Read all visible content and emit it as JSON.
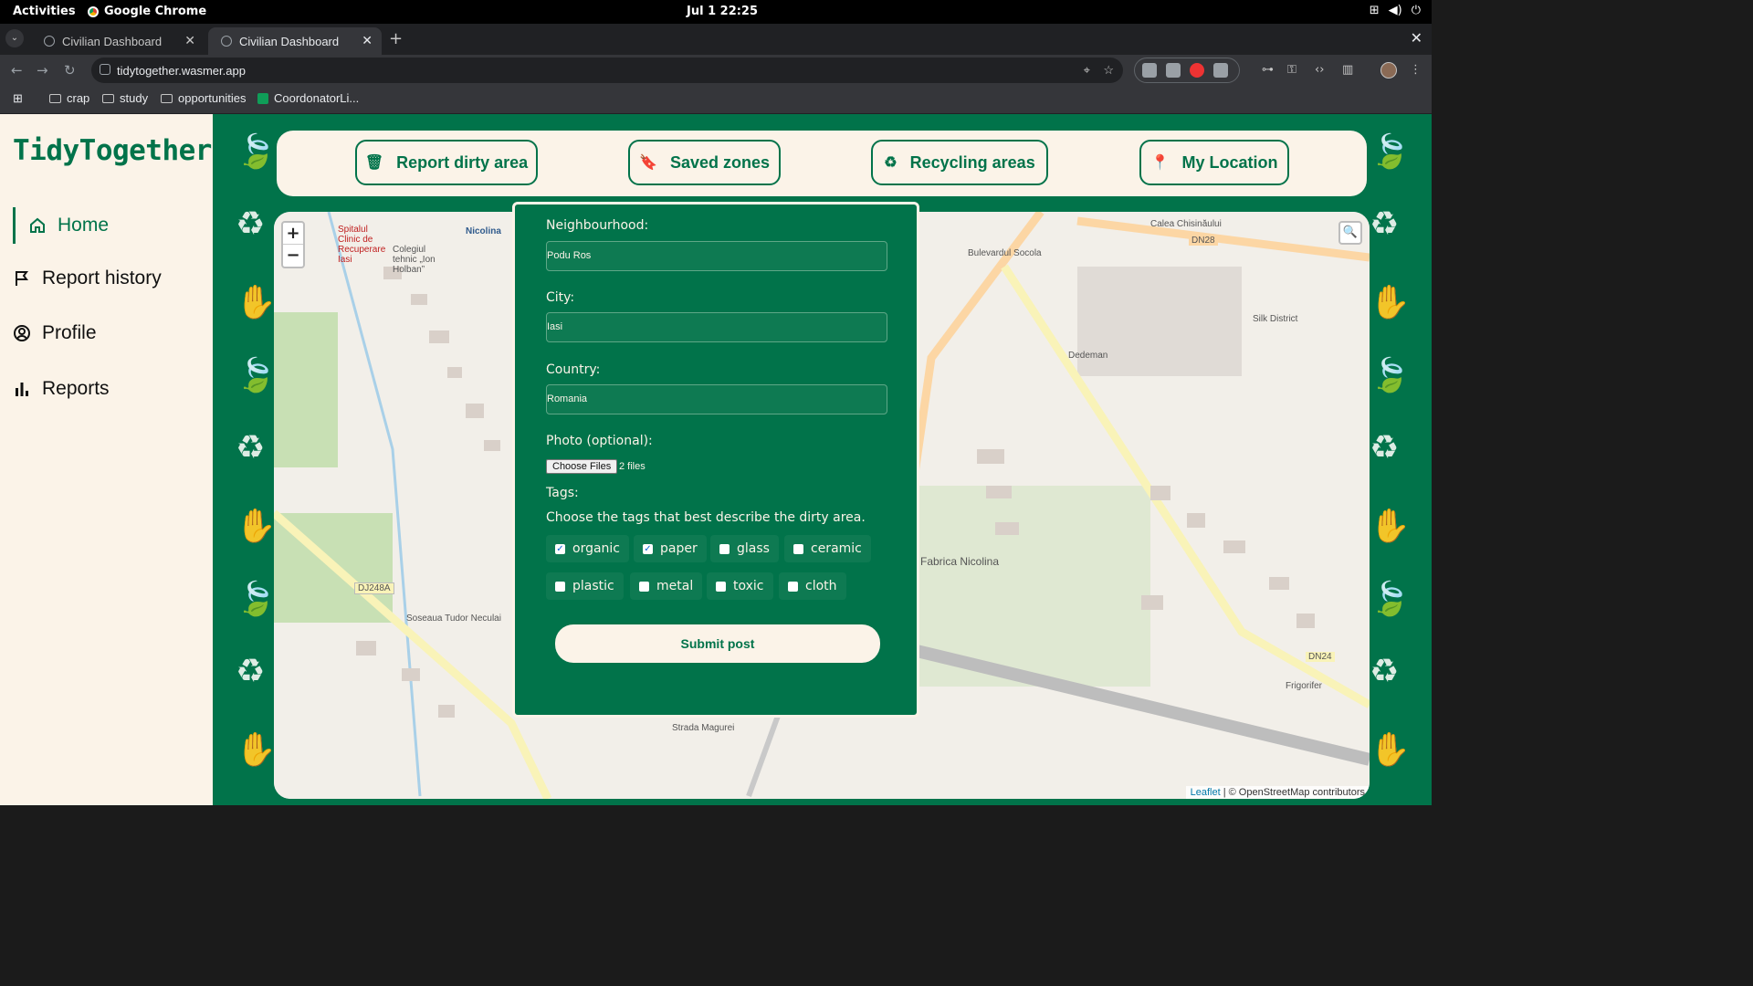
{
  "os": {
    "activities": "Activities",
    "app_name": "Google Chrome",
    "clock": "Jul 1  22:25"
  },
  "browser": {
    "tabs": [
      {
        "title": "Civilian Dashboard",
        "active": false
      },
      {
        "title": "Civilian Dashboard",
        "active": true
      }
    ],
    "url": "tidytogether.wasmer.app",
    "bookmarks": [
      "crap",
      "study",
      "opportunities",
      "CoordonatorLi..."
    ]
  },
  "sidebar": {
    "logo": "TidyTogether",
    "items": [
      {
        "label": "Home",
        "icon": "home-icon",
        "active": true
      },
      {
        "label": "Report history",
        "icon": "flag-icon",
        "active": false
      },
      {
        "label": "Profile",
        "icon": "user-circle-icon",
        "active": false
      },
      {
        "label": "Reports",
        "icon": "bar-chart-icon",
        "active": false
      }
    ]
  },
  "topnav": {
    "buttons": [
      {
        "label": "Report dirty area",
        "icon": "trash-icon"
      },
      {
        "label": "Saved zones",
        "icon": "bookmark-icon"
      },
      {
        "label": "Recycling areas",
        "icon": "recycle-icon"
      },
      {
        "label": "My Location",
        "icon": "location-pin-icon"
      }
    ]
  },
  "map": {
    "zoom_in": "+",
    "zoom_out": "−",
    "attribution_link": "Leaflet",
    "attribution_text": "| © OpenStreetMap contributors",
    "labels": [
      "Nicolina",
      "Spitalul Clinic de Recuperare Iasi",
      "Colegiul tehnic „Ion Holban”",
      "DJ248A",
      "Soseaua Tudor Neculai",
      "Fabrica Nicolina",
      "Dedeman",
      "Silk District",
      "Calea Chisinăului",
      "DN28",
      "DN24",
      "Bulevardul Socola",
      "Frigorifer",
      "Strada Magurei"
    ]
  },
  "form": {
    "neighbourhood_label": "Neighbourhood:",
    "neighbourhood_value": "Podu Ros",
    "city_label": "City:",
    "city_value": "Iasi",
    "country_label": "Country:",
    "country_value": "Romania",
    "photo_label": "Photo (optional):",
    "choose_files": "Choose Files",
    "file_count": "2 files",
    "tags_label": "Tags:",
    "tags_hint": "Choose the tags that best describe the dirty area.",
    "tags": [
      {
        "label": "organic",
        "checked": true
      },
      {
        "label": "paper",
        "checked": true
      },
      {
        "label": "glass",
        "checked": false
      },
      {
        "label": "ceramic",
        "checked": false
      },
      {
        "label": "plastic",
        "checked": false
      },
      {
        "label": "metal",
        "checked": false
      },
      {
        "label": "toxic",
        "checked": false
      },
      {
        "label": "cloth",
        "checked": false
      }
    ],
    "submit": "Submit post"
  },
  "colors": {
    "brand_green": "#01734a",
    "cream": "#fbf3e8"
  }
}
